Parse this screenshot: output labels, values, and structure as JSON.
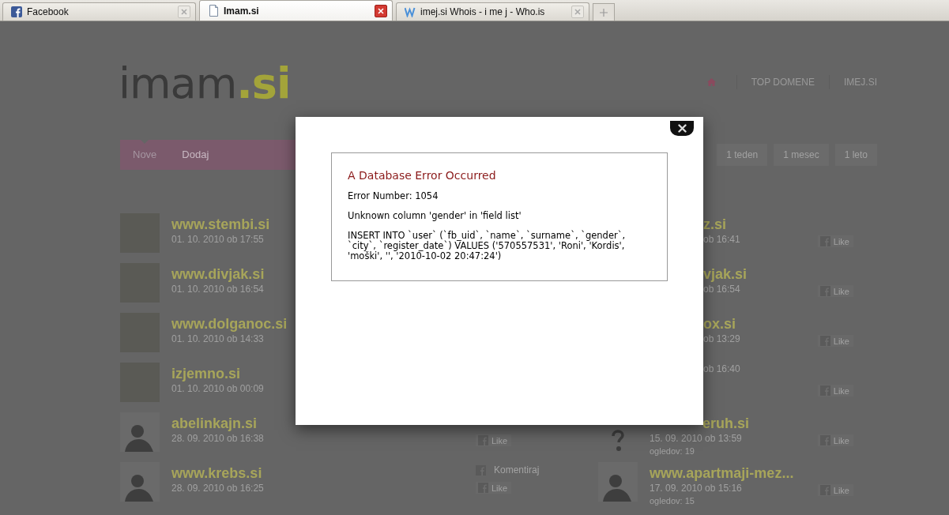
{
  "browser_tabs": [
    {
      "title": "Facebook",
      "selected": false
    },
    {
      "title": "Imam.si",
      "selected": true
    },
    {
      "title": "imej.si Whois - i me j - Who.is",
      "selected": false
    }
  ],
  "logo": {
    "name": "imam",
    "suffix": ".si"
  },
  "top_nav": [
    "TOP DOMENE",
    "IMEJ.SI"
  ],
  "menu": [
    {
      "label": "Nove",
      "selected": true
    },
    {
      "label": "Dodaj",
      "selected": false
    }
  ],
  "period_filters": [
    "1 teden",
    "1 mesec",
    "1 leto"
  ],
  "rows": [
    {
      "left": {
        "avatar": {
          "kind": "photo"
        },
        "title": "www.stembi.si",
        "date": "01. 10. 2010 ob 17:55"
      },
      "right": {
        "kind": "clipped",
        "title": "z.si",
        "date": "ob 16:41",
        "like": "Like"
      }
    },
    {
      "left": {
        "avatar": {
          "kind": "photo"
        },
        "title": "www.divjak.si",
        "date": "01. 10. 2010 ob 16:54"
      },
      "right": {
        "kind": "clipped",
        "title": "vjak.si",
        "date": "ob 16:54",
        "like": "Like"
      }
    },
    {
      "left": {
        "avatar": {
          "kind": "photo"
        },
        "title": "www.dolganoc.si",
        "date": "01. 10. 2010 ob 14:33"
      },
      "right": {
        "kind": "clipped",
        "title": "ox.si",
        "date": "ob 13:29",
        "like": "Like"
      }
    },
    {
      "left": {
        "avatar": {
          "kind": "photo"
        },
        "title": "izjemno.si",
        "date": "01. 10. 2010 ob 00:09"
      },
      "right": {
        "kind": "clipped",
        "date": "ob 16:40",
        "like": "Like"
      }
    },
    {
      "left": {
        "avatar": {
          "kind": "silhouette"
        },
        "title": "abelinkajn.si",
        "date": "28. 09. 2010 ob 16:38"
      },
      "middle": [
        {
          "kind": "like",
          "label": "Like"
        }
      ],
      "right": {
        "kind": "clipped_title",
        "avatar": {
          "kind": "unknown"
        },
        "title": "eruh.si",
        "date": "15. 09. 2010 ob 13:59",
        "views": "ogledov: 19",
        "like": "Like"
      }
    },
    {
      "left": {
        "avatar": {
          "kind": "silhouette"
        },
        "title": "www.krebs.si",
        "date": "28. 09. 2010 ob 16:25"
      },
      "middle": [
        {
          "kind": "comment",
          "label": "Komentiraj"
        },
        {
          "kind": "like",
          "label": "Like"
        }
      ],
      "right": {
        "kind": "full",
        "avatar": {
          "kind": "silhouette"
        },
        "title": "www.apartmaji-mez...",
        "date": "17. 09. 2010 ob 15:16",
        "views": "ogledov: 15",
        "like": "Like"
      }
    }
  ],
  "dialog": {
    "title": "A Database Error Occurred",
    "lines": [
      "Error Number: 1054",
      "Unknown column 'gender' in 'field list'",
      "INSERT INTO `user` (`fb_uid`, `name`, `surname`, `gender`, `city`, `register_date`) VALUES ('570557531', 'Roni', 'Kordis', 'moški', '', '2010-10-02 20:47:24')"
    ]
  }
}
